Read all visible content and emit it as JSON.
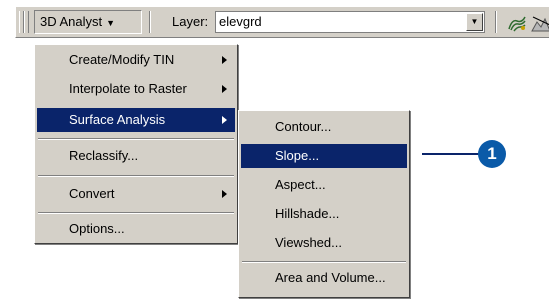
{
  "toolbar": {
    "menu_label": "3D Analyst",
    "menu_arrow": "▼",
    "layer_label": "Layer:",
    "layer_value": "elevgrd",
    "dropdown_arrow": "▼",
    "icons": [
      "contour-tool-icon",
      "line-of-sight-icon"
    ]
  },
  "menu": {
    "items": [
      {
        "label": "Create/Modify TIN",
        "submenu": true
      },
      {
        "label": "Interpolate to Raster",
        "submenu": true
      },
      {
        "label": "Surface Analysis",
        "submenu": true,
        "highlighted": true
      },
      {
        "label": "Reclassify..."
      },
      {
        "label": "Convert",
        "submenu": true
      },
      {
        "label": "Options..."
      }
    ]
  },
  "submenu": {
    "items": [
      {
        "label": "Contour..."
      },
      {
        "label": "Slope...",
        "highlighted": true
      },
      {
        "label": "Aspect..."
      },
      {
        "label": "Hillshade..."
      },
      {
        "label": "Viewshed..."
      },
      {
        "label": "Area and Volume..."
      }
    ]
  },
  "callout": {
    "number": "1"
  },
  "colors": {
    "highlight": "#0a246a",
    "face": "#d4d0c8",
    "callout": "#0a5aa8"
  }
}
